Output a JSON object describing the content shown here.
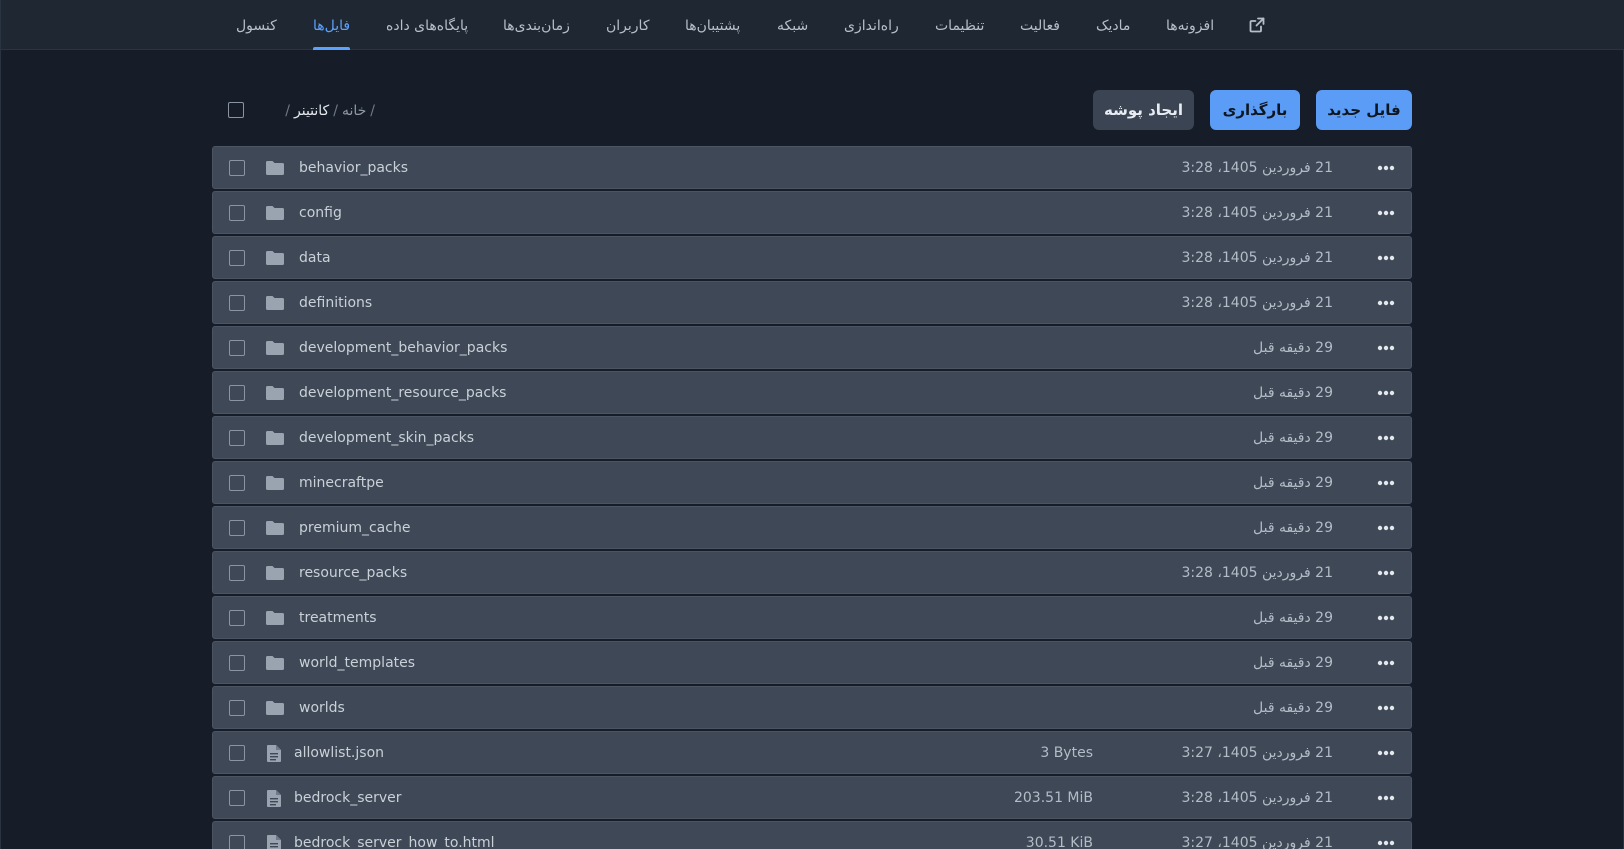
{
  "nav": {
    "items": [
      {
        "label": "کنسول",
        "active": false
      },
      {
        "label": "فایل‌ها",
        "active": true
      },
      {
        "label": "پایگاه‌های داده",
        "active": false
      },
      {
        "label": "زمان‌بندی‌ها",
        "active": false
      },
      {
        "label": "کاربران",
        "active": false
      },
      {
        "label": "پشتیبان‌ها",
        "active": false
      },
      {
        "label": "شبکه",
        "active": false
      },
      {
        "label": "راه‌اندازی",
        "active": false
      },
      {
        "label": "تنظیمات",
        "active": false
      },
      {
        "label": "فعالیت",
        "active": false
      },
      {
        "label": "مادیک",
        "active": false
      },
      {
        "label": "افزونه‌ها",
        "active": false
      }
    ],
    "external_icon": "external-link-icon",
    "accent_color": "#5aa2ff"
  },
  "toolbar": {
    "new_file_label": "فایل جدید",
    "upload_label": "بارگذاری",
    "create_folder_label": "ایجاد پوشه"
  },
  "breadcrumb": {
    "root": "خانه",
    "current": "کانتینر",
    "separator": "/"
  },
  "files": [
    {
      "name": "behavior_packs",
      "type": "folder",
      "size": "",
      "date": "21 فروردین 1405، 3:28"
    },
    {
      "name": "config",
      "type": "folder",
      "size": "",
      "date": "21 فروردین 1405، 3:28"
    },
    {
      "name": "data",
      "type": "folder",
      "size": "",
      "date": "21 فروردین 1405، 3:28"
    },
    {
      "name": "definitions",
      "type": "folder",
      "size": "",
      "date": "21 فروردین 1405، 3:28"
    },
    {
      "name": "development_behavior_packs",
      "type": "folder",
      "size": "",
      "date": "29 دقیقه قبل"
    },
    {
      "name": "development_resource_packs",
      "type": "folder",
      "size": "",
      "date": "29 دقیقه قبل"
    },
    {
      "name": "development_skin_packs",
      "type": "folder",
      "size": "",
      "date": "29 دقیقه قبل"
    },
    {
      "name": "minecraftpe",
      "type": "folder",
      "size": "",
      "date": "29 دقیقه قبل"
    },
    {
      "name": "premium_cache",
      "type": "folder",
      "size": "",
      "date": "29 دقیقه قبل"
    },
    {
      "name": "resource_packs",
      "type": "folder",
      "size": "",
      "date": "21 فروردین 1405، 3:28"
    },
    {
      "name": "treatments",
      "type": "folder",
      "size": "",
      "date": "29 دقیقه قبل"
    },
    {
      "name": "world_templates",
      "type": "folder",
      "size": "",
      "date": "29 دقیقه قبل"
    },
    {
      "name": "worlds",
      "type": "folder",
      "size": "",
      "date": "29 دقیقه قبل"
    },
    {
      "name": "allowlist.json",
      "type": "file",
      "size": "3 Bytes",
      "date": "21 فروردین 1405، 3:27"
    },
    {
      "name": "bedrock_server",
      "type": "file",
      "size": "203.51 MiB",
      "date": "21 فروردین 1405، 3:28"
    },
    {
      "name": "bedrock_server_how_to.html",
      "type": "file",
      "size": "30.51 KiB",
      "date": "21 فروردین 1405، 3:27"
    }
  ],
  "icons": {
    "folder": "folder-icon",
    "file": "file-icon",
    "more": "more-options-icon"
  },
  "colors": {
    "background": "#161d28",
    "nav_background": "#1f2732",
    "row_background": "#3e4856",
    "primary_button": "#5b9cf6",
    "secondary_button": "#3a4453"
  }
}
